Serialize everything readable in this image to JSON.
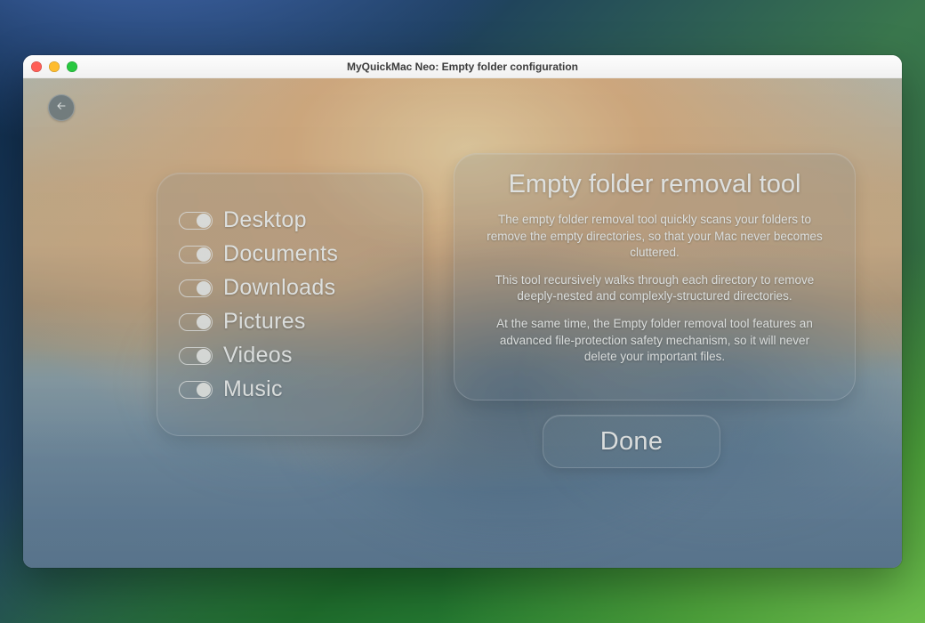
{
  "window": {
    "title": "MyQuickMac Neo: Empty folder configuration"
  },
  "back": {
    "aria": "Back"
  },
  "folders": [
    {
      "label": "Desktop",
      "on": true
    },
    {
      "label": "Documents",
      "on": true
    },
    {
      "label": "Downloads",
      "on": true
    },
    {
      "label": "Pictures",
      "on": true
    },
    {
      "label": "Videos",
      "on": true
    },
    {
      "label": "Music",
      "on": true
    }
  ],
  "info": {
    "title": "Empty folder removal tool",
    "p1": "The empty folder removal tool quickly scans your folders to remove the empty directories, so that your Mac never becomes cluttered.",
    "p2": "This tool recursively walks through each directory to remove deeply-nested and complexly-structured directories.",
    "p3": "At the same time, the Empty folder removal tool features an advanced file-protection safety mechanism, so it will never delete your important files."
  },
  "done": {
    "label": "Done"
  }
}
